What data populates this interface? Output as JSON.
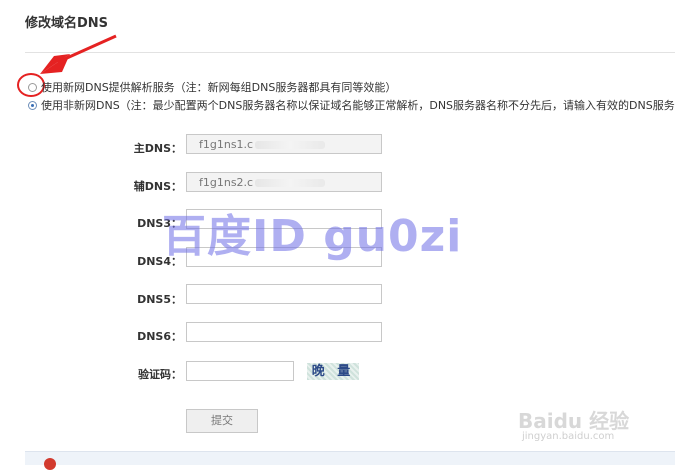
{
  "page": {
    "title": "修改域名DNS"
  },
  "options": [
    {
      "label": "使用新网DNS提供解析服务（注：新网每组DNS服务器都具有同等效能）",
      "selected": false
    },
    {
      "label": "使用非新网DNS（注：最少配置两个DNS服务器名称以保证域名能够正常解析，DNS服务器名称不分先后，请输入有效的DNS服务",
      "selected": true
    }
  ],
  "form": {
    "fields": [
      {
        "label": "主DNS：",
        "value": "f1g1ns1.c",
        "placeholder": ""
      },
      {
        "label": "辅DNS：",
        "value": "f1g1ns2.c",
        "placeholder": ""
      },
      {
        "label": "DNS3：",
        "value": "",
        "placeholder": ""
      },
      {
        "label": "DNS4：",
        "value": "",
        "placeholder": ""
      },
      {
        "label": "DNS5：",
        "value": "",
        "placeholder": ""
      },
      {
        "label": "DNS6：",
        "value": "",
        "placeholder": ""
      }
    ],
    "captcha": {
      "label": "验证码：",
      "value": "",
      "image_text": "晚 量"
    },
    "submit_label": "提交"
  },
  "overlay": {
    "watermark": "百度ID gu0zi",
    "baidu_logo": "Baidu 经验",
    "baidu_url": "jingyan.baidu.com"
  },
  "colors": {
    "accent_red": "#e52222",
    "radio_blue": "#3a6fb6",
    "watermark": "#6e6ee6"
  }
}
